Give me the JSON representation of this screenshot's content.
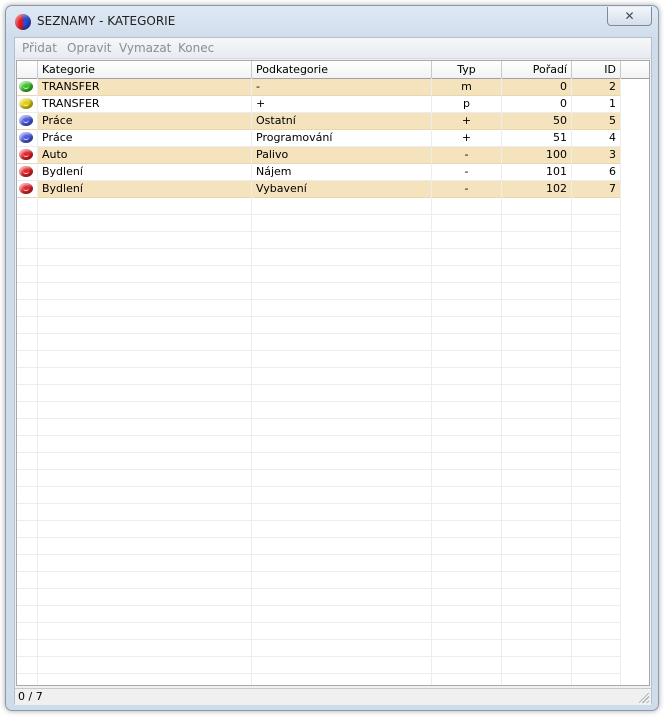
{
  "window": {
    "title": "SEZNAMY - KATEGORIE",
    "close_symbol": "✕"
  },
  "menu": {
    "items": [
      "Přidat",
      "Opravit",
      "Vymazat",
      "Konec"
    ]
  },
  "table": {
    "columns": [
      "",
      "Kategorie",
      "Podkategorie",
      "Typ",
      "Pořadí",
      "ID"
    ],
    "rows": [
      {
        "color": "#3fbf2e",
        "kategorie": "TRANSFER",
        "podkategorie": "-",
        "typ": "m",
        "poradi": "0",
        "id": "2"
      },
      {
        "color": "#e3cd10",
        "kategorie": "TRANSFER",
        "podkategorie": "+",
        "typ": "p",
        "poradi": "0",
        "id": "1"
      },
      {
        "color": "#4f5be0",
        "kategorie": "Práce",
        "podkategorie": "Ostatní",
        "typ": "+",
        "poradi": "50",
        "id": "5"
      },
      {
        "color": "#4f5be0",
        "kategorie": "Práce",
        "podkategorie": "Programování",
        "typ": "+",
        "poradi": "51",
        "id": "4"
      },
      {
        "color": "#e2262c",
        "kategorie": "Auto",
        "podkategorie": "Palivo",
        "typ": "-",
        "poradi": "100",
        "id": "3"
      },
      {
        "color": "#e2262c",
        "kategorie": "Bydlení",
        "podkategorie": "Nájem",
        "typ": "-",
        "poradi": "101",
        "id": "6"
      },
      {
        "color": "#e2262c",
        "kategorie": "Bydlení",
        "podkategorie": "Vybavení",
        "typ": "-",
        "poradi": "102",
        "id": "7"
      }
    ]
  },
  "status": {
    "text": "0 / 7"
  },
  "colors": {
    "row_highlight": "#f5e3bd",
    "window_frame": "#cfdceb"
  }
}
